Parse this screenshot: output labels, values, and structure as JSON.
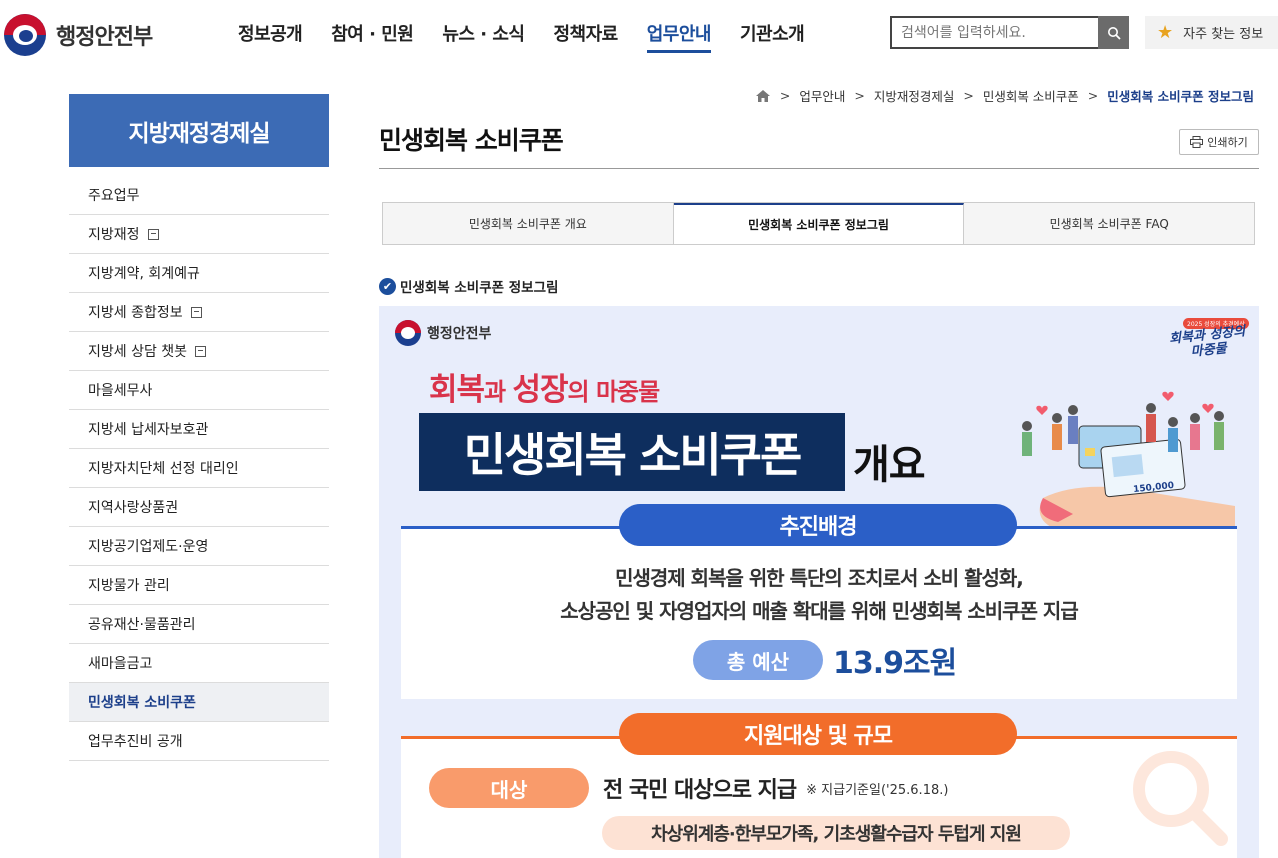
{
  "header": {
    "logo_text": "행정안전부",
    "nav": [
      "정보공개",
      "참여 · 민원",
      "뉴스 · 소식",
      "정책자료",
      "업무안내",
      "기관소개"
    ],
    "active_nav": "업무안내",
    "search_placeholder": "검색어를 입력하세요.",
    "favorites_label": "자주 찾는 정보"
  },
  "breadcrumb": [
    "업무안내",
    "지방재정경제실",
    "민생회복 소비쿠폰",
    "민생회복 소비쿠폰 정보그림"
  ],
  "sidebar": {
    "title": "지방재정경제실",
    "items": [
      {
        "label": "주요업무",
        "external": false
      },
      {
        "label": "지방재정",
        "external": true
      },
      {
        "label": "지방계약, 회계예규",
        "external": false
      },
      {
        "label": "지방세 종합정보",
        "external": true
      },
      {
        "label": "지방세 상담 챗봇",
        "external": true
      },
      {
        "label": "마을세무사",
        "external": false
      },
      {
        "label": "지방세 납세자보호관",
        "external": false
      },
      {
        "label": "지방자치단체 선정 대리인",
        "external": false
      },
      {
        "label": "지역사랑상품권",
        "external": false
      },
      {
        "label": "지방공기업제도·운영",
        "external": false
      },
      {
        "label": "지방물가 관리",
        "external": false
      },
      {
        "label": "공유재산·물품관리",
        "external": false
      },
      {
        "label": "새마을금고",
        "external": false
      },
      {
        "label": "민생회복 소비쿠폰",
        "external": false,
        "active": true
      },
      {
        "label": "업무추진비 공개",
        "external": false
      }
    ]
  },
  "main": {
    "title": "민생회복 소비쿠폰",
    "print_label": "인쇄하기",
    "tabs": [
      "민생회복 소비쿠폰 개요",
      "민생회복 소비쿠폰 정보그림",
      "민생회복 소비쿠폰 FAQ"
    ],
    "active_tab": 1,
    "section_heading": "민생회복 소비쿠폰 정보그림"
  },
  "infographic": {
    "logo_text": "행정안전부",
    "badge_small": "2025 성장의 추경예산",
    "badge_line1": "회복과 성장의",
    "badge_line2": "마중물",
    "slogan_a": "회복",
    "slogan_b": "과 ",
    "slogan_c": "성장",
    "slogan_d": "의 마중물",
    "main_title": "민생회복 소비쿠폰",
    "main_suffix": "개요",
    "coupon_amount": "150,000",
    "section1_title": "추진배경",
    "section1_line1": "민생경제 회복을 위한 특단의 조치로서 소비 활성화,",
    "section1_line2": "소상공인 및 자영업자의 매출 확대를 위해 민생회복 소비쿠폰 지급",
    "budget_label": "총 예산",
    "budget_value": "13.9조원",
    "section2_title": "지원대상 및 규모",
    "target_label": "대상",
    "target_value": "전 국민 대상으로 지급",
    "target_note": "※ 지급기준일('25.6.18.)",
    "target_sub": "차상위계층·한부모가족, 기초생활수급자 두텁게 지원"
  },
  "colors": {
    "brand_blue": "#1c4e9c",
    "sidebar_title_bg": "#3c6bb5",
    "info_navy": "#0e2e5e",
    "info_blue": "#2b5fc7",
    "info_orange": "#f26d2a",
    "slogan_red": "#d9334a"
  }
}
